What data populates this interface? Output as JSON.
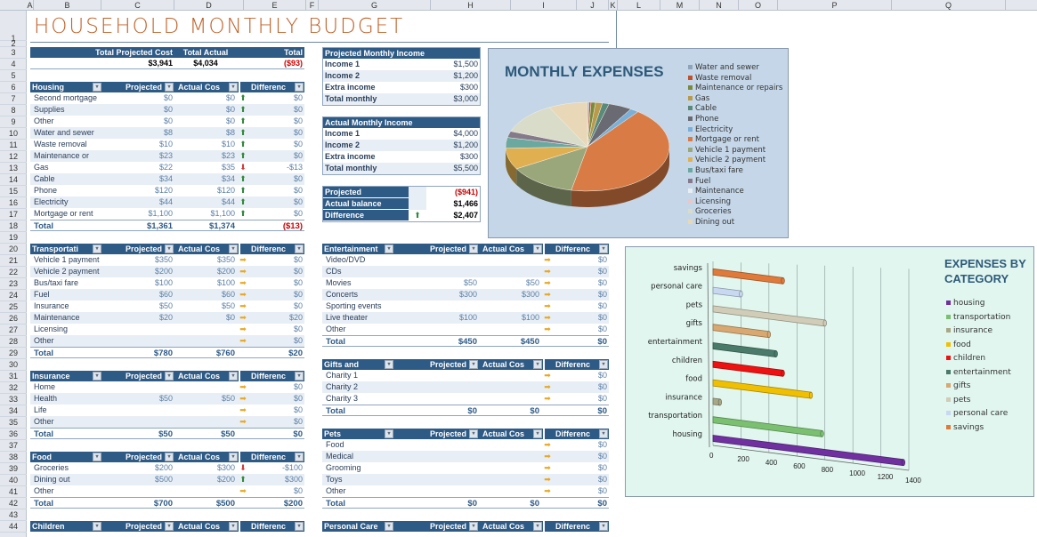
{
  "columns": [
    "A",
    "B",
    "C",
    "D",
    "E",
    "F",
    "G",
    "H",
    "I",
    "J",
    "K",
    "L",
    "M",
    "N",
    "O",
    "P",
    "Q"
  ],
  "rows": [
    "1",
    "2",
    "3",
    "4",
    "5",
    "6",
    "7",
    "8",
    "9",
    "10",
    "11",
    "12",
    "13",
    "14",
    "15",
    "16",
    "17",
    "18",
    "19",
    "20",
    "21",
    "22",
    "23",
    "24",
    "25",
    "26",
    "27",
    "28",
    "29",
    "30",
    "31",
    "32",
    "33",
    "34",
    "35",
    "36",
    "37",
    "38",
    "39",
    "40",
    "41",
    "42",
    "43",
    "44"
  ],
  "title": "HOUSEHOLD MONTHLY BUDGET",
  "summary": {
    "headers": [
      "Total Projected Cost",
      "Total Actual",
      "Total"
    ],
    "values": [
      "$3,941",
      "$4,034",
      "($93)"
    ]
  },
  "table_headers": {
    "projected": "Projected",
    "actual": "Actual Cos",
    "difference": "Differenc",
    "dropdown": "▾"
  },
  "tables_left": [
    {
      "name": "Housing",
      "rows": [
        [
          "Second mortgage",
          "$0",
          "$0",
          "up",
          "$0"
        ],
        [
          "Supplies",
          "$0",
          "$0",
          "up",
          "$0"
        ],
        [
          "Other",
          "$0",
          "$0",
          "up",
          "$0"
        ],
        [
          "Water and sewer",
          "$8",
          "$8",
          "up",
          "$0"
        ],
        [
          "Waste removal",
          "$10",
          "$10",
          "up",
          "$0"
        ],
        [
          "Maintenance or",
          "$23",
          "$23",
          "up",
          "$0"
        ],
        [
          "Gas",
          "$22",
          "$35",
          "down",
          "-$13"
        ],
        [
          "Cable",
          "$34",
          "$34",
          "up",
          "$0"
        ],
        [
          "Phone",
          "$120",
          "$120",
          "up",
          "$0"
        ],
        [
          "Electricity",
          "$44",
          "$44",
          "up",
          "$0"
        ],
        [
          "Mortgage or rent",
          "$1,100",
          "$1,100",
          "up",
          "$0"
        ]
      ],
      "total": [
        "Total",
        "$1,361",
        "$1,374",
        "($13)"
      ]
    },
    {
      "name": "Transportati",
      "rows": [
        [
          "Vehicle 1 payment",
          "$350",
          "$350",
          "right",
          "$0"
        ],
        [
          "Vehicle 2 payment",
          "$200",
          "$200",
          "right",
          "$0"
        ],
        [
          "Bus/taxi fare",
          "$100",
          "$100",
          "right",
          "$0"
        ],
        [
          "Fuel",
          "$60",
          "$60",
          "right",
          "$0"
        ],
        [
          "Insurance",
          "$50",
          "$50",
          "right",
          "$0"
        ],
        [
          "Maintenance",
          "$20",
          "$0",
          "right",
          "$20"
        ],
        [
          "Licensing",
          "",
          "",
          "right",
          "$0"
        ],
        [
          "Other",
          "",
          "",
          "right",
          "$0"
        ]
      ],
      "total": [
        "Total",
        "$780",
        "$760",
        "$20"
      ]
    },
    {
      "name": "Insurance",
      "rows": [
        [
          "Home",
          "",
          "",
          "right",
          "$0"
        ],
        [
          "Health",
          "$50",
          "$50",
          "right",
          "$0"
        ],
        [
          "Life",
          "",
          "",
          "right",
          "$0"
        ],
        [
          "Other",
          "",
          "",
          "right",
          "$0"
        ]
      ],
      "total": [
        "Total",
        "$50",
        "$50",
        "$0"
      ]
    },
    {
      "name": "Food",
      "rows": [
        [
          "Groceries",
          "$200",
          "$300",
          "down",
          "-$100"
        ],
        [
          "Dining out",
          "$500",
          "$200",
          "up",
          "$300"
        ],
        [
          "Other",
          "",
          "",
          "right",
          "$0"
        ]
      ],
      "total": [
        "Total",
        "$700",
        "$500",
        "$200"
      ]
    },
    {
      "name": "Children",
      "rows": [],
      "total": null
    }
  ],
  "tables_right": [
    {
      "name": "Entertainment",
      "rows": [
        [
          "Video/DVD",
          "",
          "",
          "right",
          "$0"
        ],
        [
          "CDs",
          "",
          "",
          "right",
          "$0"
        ],
        [
          "Movies",
          "$50",
          "$50",
          "right",
          "$0"
        ],
        [
          "Concerts",
          "$300",
          "$300",
          "right",
          "$0"
        ],
        [
          "Sporting events",
          "",
          "",
          "right",
          "$0"
        ],
        [
          "Live theater",
          "$100",
          "$100",
          "right",
          "$0"
        ],
        [
          "Other",
          "",
          "",
          "right",
          "$0"
        ]
      ],
      "total": [
        "Total",
        "$450",
        "$450",
        "$0"
      ]
    },
    {
      "name": "Gifts and",
      "rows": [
        [
          "Charity 1",
          "",
          "",
          "right",
          "$0"
        ],
        [
          "Charity 2",
          "",
          "",
          "right",
          "$0"
        ],
        [
          "Charity 3",
          "",
          "",
          "right",
          "$0"
        ]
      ],
      "total": [
        "Total",
        "$0",
        "$0",
        "$0"
      ]
    },
    {
      "name": "Pets",
      "rows": [
        [
          "Food",
          "",
          "",
          "right",
          "$0"
        ],
        [
          "Medical",
          "",
          "",
          "right",
          "$0"
        ],
        [
          "Grooming",
          "",
          "",
          "right",
          "$0"
        ],
        [
          "Toys",
          "",
          "",
          "right",
          "$0"
        ],
        [
          "Other",
          "",
          "",
          "right",
          "$0"
        ]
      ],
      "total": [
        "Total",
        "$0",
        "$0",
        "$0"
      ]
    },
    {
      "name": "Personal Care",
      "rows": [],
      "total": null
    }
  ],
  "projected_income": {
    "title": "Projected Monthly Income",
    "rows": [
      [
        "Income 1",
        "$1,500"
      ],
      [
        "Income 2",
        "$1,200"
      ],
      [
        "Extra income",
        "$300"
      ],
      [
        "Total monthly",
        "$3,000"
      ]
    ]
  },
  "actual_income": {
    "title": "Actual Monthly Income",
    "rows": [
      [
        "Income 1",
        "$4,000"
      ],
      [
        "Income 2",
        "$1,200"
      ],
      [
        "Extra income",
        "$300"
      ],
      [
        "Total monthly",
        "$5,500"
      ]
    ]
  },
  "balance": {
    "rows": [
      [
        "Projected",
        "",
        "($941)"
      ],
      [
        "Actual balance",
        "",
        "$1,466"
      ],
      [
        "Difference",
        "up",
        "$2,407"
      ]
    ]
  },
  "chart_data": [
    {
      "type": "pie",
      "title": "MONTHLY EXPENSES",
      "legend_position": "right",
      "categories": [
        "Water and sewer",
        "Waste removal",
        "Maintenance or repairs",
        "Gas",
        "Cable",
        "Phone",
        "Electricity",
        "Mortgage or rent",
        "Vehicle 1 payment",
        "Vehicle 2 payment",
        "Bus/taxi fare",
        "Fuel",
        "Maintenance",
        "Licensing",
        "Groceries",
        "Dining out"
      ],
      "values": [
        8,
        10,
        23,
        35,
        34,
        120,
        44,
        1100,
        350,
        200,
        100,
        60,
        0,
        0,
        300,
        200
      ],
      "colors": [
        "#8fa4b8",
        "#c0502a",
        "#7a8a3a",
        "#b89a4a",
        "#5a8a7a",
        "#6a6a72",
        "#7ab0d8",
        "#d97b45",
        "#9aa77a",
        "#e0b050",
        "#6aa8a0",
        "#857a8a",
        "#e8eef2",
        "#e8c8c8",
        "#d8dcc8",
        "#e8d8b8"
      ]
    },
    {
      "type": "bar",
      "title": "EXPENSES BY CATEGORY",
      "legend_position": "right",
      "categories": [
        "housing",
        "transportation",
        "insurance",
        "food",
        "children",
        "entertainment",
        "gifts",
        "pets",
        "personal care",
        "savings"
      ],
      "values": [
        1361,
        780,
        50,
        700,
        500,
        450,
        400,
        800,
        200,
        500
      ],
      "colors": [
        "#7030a0",
        "#7ac070",
        "#a8a888",
        "#f0c000",
        "#ee1111",
        "#4a7a6a",
        "#d8a870",
        "#d0ccb8",
        "#c8d8f0",
        "#e07a3a"
      ],
      "xlim": [
        0,
        1400
      ],
      "xticks": [
        "0",
        "200",
        "400",
        "600",
        "800",
        "1000",
        "1200",
        "1400"
      ]
    }
  ]
}
